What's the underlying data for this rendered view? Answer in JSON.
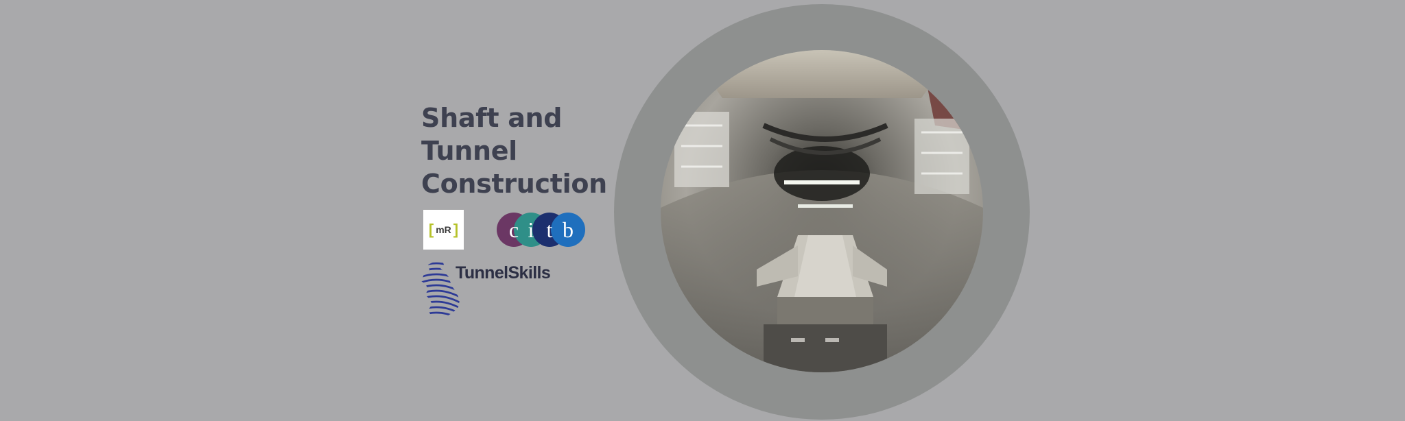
{
  "title": {
    "line1": "Shaft and",
    "line2": "Tunnel",
    "line3": "Construction"
  },
  "logos": {
    "mr": {
      "text": "mR",
      "bracket_color": "#b6c22a"
    },
    "citb": {
      "letters": [
        "c",
        "i",
        "t",
        "b"
      ],
      "colors": [
        "#6b3764",
        "#2f8f88",
        "#1c2f6e",
        "#1f6fbd"
      ]
    },
    "tunnelskills": {
      "text": "TunnelSkills",
      "color": "#2c2f44"
    }
  },
  "colors": {
    "background": "#a9a9ab",
    "ring": "#8e908f",
    "title": "#3e4150"
  }
}
